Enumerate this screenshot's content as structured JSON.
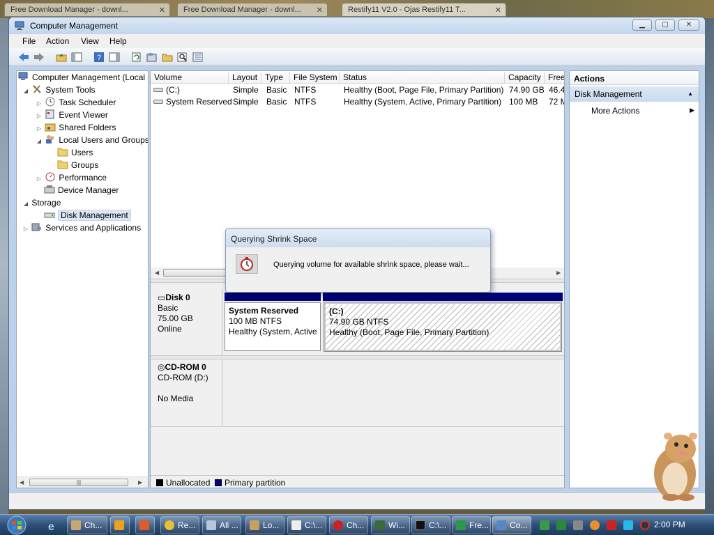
{
  "background_tabs": [
    {
      "label": "Free Download Manager - downl..."
    },
    {
      "label": "Free Download Manager - downl..."
    },
    {
      "label": "Restify11 V2.0 - Ojas Restify11 T..."
    }
  ],
  "window": {
    "title": "Computer Management"
  },
  "menu": [
    "File",
    "Action",
    "View",
    "Help"
  ],
  "tree": {
    "root": "Computer Management (Local",
    "items": [
      {
        "label": "System Tools"
      },
      {
        "label": "Task Scheduler"
      },
      {
        "label": "Event Viewer"
      },
      {
        "label": "Shared Folders"
      },
      {
        "label": "Local Users and Groups"
      },
      {
        "label": "Users"
      },
      {
        "label": "Groups"
      },
      {
        "label": "Performance"
      },
      {
        "label": "Device Manager"
      },
      {
        "label": "Storage"
      },
      {
        "label": "Disk Management"
      },
      {
        "label": "Services and Applications"
      }
    ]
  },
  "volume_list": {
    "columns": [
      "Volume",
      "Layout",
      "Type",
      "File System",
      "Status",
      "Capacity",
      "Free"
    ],
    "rows": [
      {
        "volume": "(C:)",
        "layout": "Simple",
        "type": "Basic",
        "fs": "NTFS",
        "status": "Healthy (Boot, Page File, Primary Partition)",
        "capacity": "74.90 GB",
        "free": "46.40"
      },
      {
        "volume": "System Reserved",
        "layout": "Simple",
        "type": "Basic",
        "fs": "NTFS",
        "status": "Healthy (System, Active, Primary Partition)",
        "capacity": "100 MB",
        "free": "72 M"
      }
    ]
  },
  "disks": [
    {
      "name": "Disk 0",
      "line1": "Basic",
      "line2": "75.00 GB",
      "line3": "Online"
    },
    {
      "name": "CD-ROM 0",
      "line1": "CD-ROM (D:)",
      "line2": "",
      "line3": "No Media"
    }
  ],
  "partitions": [
    {
      "name": "System Reserved",
      "size": "100 MB NTFS",
      "status": "Healthy (System, Active"
    },
    {
      "name": "(C:)",
      "size": "74.90 GB NTFS",
      "status": "Healthy (Boot, Page File, Primary Partition)"
    }
  ],
  "legend": {
    "unallocated": "Unallocated",
    "primary": "Primary partition"
  },
  "actions": {
    "header": "Actions",
    "section": "Disk Management",
    "item": "More Actions"
  },
  "dialog": {
    "title": "Querying Shrink Space",
    "message": "Querying volume for available shrink space, please wait..."
  },
  "taskbar": {
    "tasks": [
      "Ch...",
      "",
      "",
      "Re...",
      "All ...",
      "Lo...",
      "C:\\...",
      "Ch...",
      "Wi...",
      "C:\\...",
      "Fre...",
      "Co..."
    ],
    "clock": "2:00 PM"
  },
  "colors": {
    "primary_partition": "#00007b",
    "unallocated": "#000000",
    "selection": "#dde8f6"
  }
}
